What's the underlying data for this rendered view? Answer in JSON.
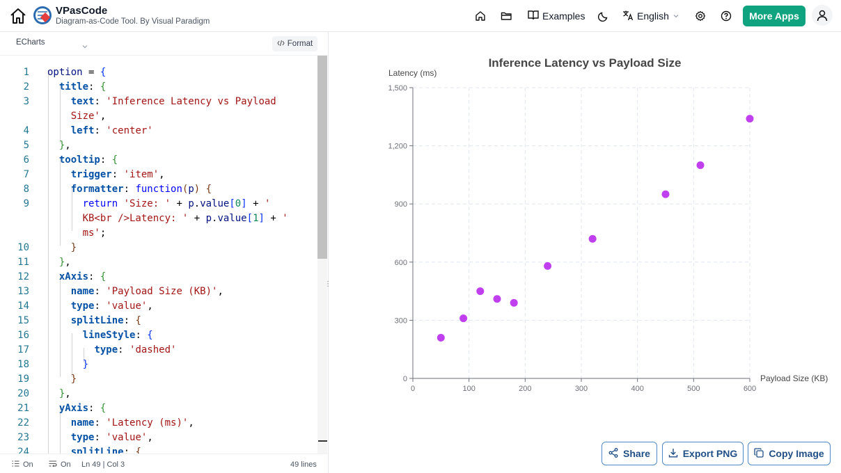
{
  "header": {
    "brand_name": "VPasCode",
    "brand_sub": "Diagram-as-Code Tool. By Visual Paradigm",
    "examples_label": "Examples",
    "language_label": "English",
    "more_apps_label": "More Apps"
  },
  "editor": {
    "language": "ECharts",
    "format_label": "Format",
    "lines": [
      {
        "n": "1",
        "y": 0,
        "html": "<span class='k' style='font-weight:400;color:#001080'>option</span> = <span class='b1'>{</span>"
      },
      {
        "n": "2",
        "y": 1,
        "html": "  <span class='k'>title</span>: <span class='b2'>{</span>"
      },
      {
        "n": "3",
        "y": 2,
        "html": "    <span class='k'>text</span>: <span class='s'>'Inference Latency vs Payload</span>"
      },
      {
        "n": "",
        "y": 3,
        "html": "    <span class='s'>Size'</span>,"
      },
      {
        "n": "4",
        "y": 4,
        "html": "    <span class='k'>left</span>: <span class='s'>'center'</span>"
      },
      {
        "n": "5",
        "y": 5,
        "html": "  <span class='b2'>}</span>,"
      },
      {
        "n": "6",
        "y": 6,
        "html": "  <span class='k'>tooltip</span>: <span class='b2'>{</span>"
      },
      {
        "n": "7",
        "y": 7,
        "html": "    <span class='k'>trigger</span>: <span class='s'>'item'</span>,"
      },
      {
        "n": "8",
        "y": 8,
        "html": "    <span class='k'>formatter</span>: <span class='fn'>function</span><span class='b3'>(</span><span class='var'>p</span><span class='b3'>)</span> <span class='b3'>{</span>"
      },
      {
        "n": "9",
        "y": 9,
        "html": "      <span class='fn'>return</span> <span class='s'>'Size: '</span> + <span class='var'>p</span>.<span class='var'>value</span><span class='b1'>[</span><span class='num'>0</span><span class='b1'>]</span> + <span class='s'>'</span>"
      },
      {
        "n": "",
        "y": 10,
        "html": "      <span class='s'>KB&lt;br /&gt;Latency: '</span> + <span class='var'>p</span>.<span class='var'>value</span><span class='b1'>[</span><span class='num'>1</span><span class='b1'>]</span> + <span class='s'>'</span>"
      },
      {
        "n": "",
        "y": 11,
        "html": "      <span class='s'>ms'</span>;"
      },
      {
        "n": "10",
        "y": 12,
        "html": "    <span class='b3'>}</span>"
      },
      {
        "n": "11",
        "y": 13,
        "html": "  <span class='b2'>}</span>,"
      },
      {
        "n": "12",
        "y": 14,
        "html": "  <span class='k'>xAxis</span>: <span class='b2'>{</span>"
      },
      {
        "n": "13",
        "y": 15,
        "html": "    <span class='k'>name</span>: <span class='s'>'Payload Size (KB)'</span>,"
      },
      {
        "n": "14",
        "y": 16,
        "html": "    <span class='k'>type</span>: <span class='s'>'value'</span>,"
      },
      {
        "n": "15",
        "y": 17,
        "html": "    <span class='k'>splitLine</span>: <span class='b3'>{</span>"
      },
      {
        "n": "16",
        "y": 18,
        "html": "      <span class='k'>lineStyle</span>: <span class='b1'>{</span>"
      },
      {
        "n": "17",
        "y": 19,
        "html": "        <span class='k'>type</span>: <span class='s'>'dashed'</span>"
      },
      {
        "n": "18",
        "y": 20,
        "html": "      <span class='b1'>}</span>"
      },
      {
        "n": "19",
        "y": 21,
        "html": "    <span class='b3'>}</span>"
      },
      {
        "n": "20",
        "y": 22,
        "html": "  <span class='b2'>}</span>,"
      },
      {
        "n": "21",
        "y": 23,
        "html": "  <span class='k'>yAxis</span>: <span class='b2'>{</span>"
      },
      {
        "n": "22",
        "y": 24,
        "html": "    <span class='k'>name</span>: <span class='s'>'Latency (ms)'</span>,"
      },
      {
        "n": "23",
        "y": 25,
        "html": "    <span class='k'>type</span>: <span class='s'>'value'</span>,"
      },
      {
        "n": "24",
        "y": 26,
        "html": "    <span class='k'>splitLine</span>: <span class='b3'>{</span>"
      }
    ]
  },
  "status": {
    "wrap": "On",
    "minimap": "On",
    "position": "Ln 49 | Col 3",
    "line_count": "49 lines"
  },
  "actions": {
    "share": "Share",
    "export_png": "Export PNG",
    "copy_image": "Copy Image"
  },
  "colors": {
    "accent": "#10a37f",
    "point": "#c040f0"
  },
  "chart_data": {
    "type": "scatter",
    "title": "Inference Latency vs Payload Size",
    "xlabel": "Payload Size (KB)",
    "ylabel": "Latency (ms)",
    "xlim": [
      0,
      600
    ],
    "ylim": [
      0,
      1500
    ],
    "xticks": [
      0,
      100,
      200,
      300,
      400,
      500,
      600
    ],
    "yticks": [
      0,
      300,
      600,
      900,
      1200,
      1500
    ],
    "ytick_labels": [
      "0",
      "300",
      "600",
      "900",
      "1,200",
      "1,500"
    ],
    "grid": true,
    "points": [
      [
        50,
        210
      ],
      [
        90,
        310
      ],
      [
        120,
        450
      ],
      [
        150,
        410
      ],
      [
        180,
        390
      ],
      [
        240,
        580
      ],
      [
        320,
        720
      ],
      [
        450,
        950
      ],
      [
        512,
        1100
      ],
      [
        600,
        1340
      ]
    ]
  }
}
